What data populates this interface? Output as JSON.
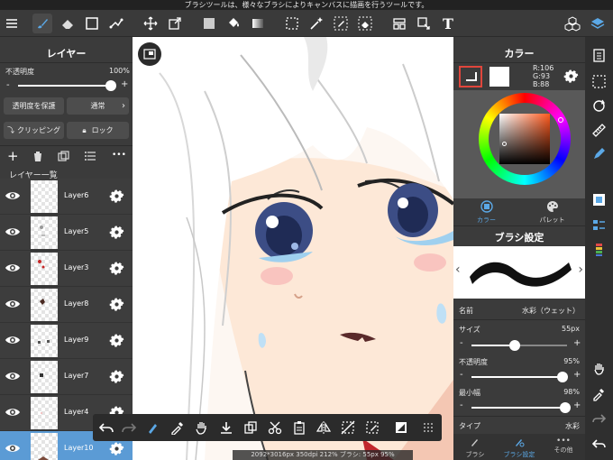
{
  "status_message": "ブラシツールは、様々なブラシによりキャンバスに描画を行うツールです。",
  "layer_panel": {
    "title": "レイヤー",
    "opacity_label": "不透明度",
    "opacity_value": "100%",
    "opacity_fraction": 1.0,
    "minus": "-",
    "plus": "+",
    "protect_alpha_label": "透明度を保護",
    "blend_mode": "通常",
    "clipping_label": "クリッピング",
    "lock_label": "ロック",
    "list_title": "レイヤー一覧",
    "more": "•••",
    "layers": [
      {
        "name": "Layer6",
        "selected": false
      },
      {
        "name": "Layer5",
        "selected": false
      },
      {
        "name": "Layer3",
        "selected": false
      },
      {
        "name": "Layer8",
        "selected": false
      },
      {
        "name": "Layer9",
        "selected": false
      },
      {
        "name": "Layer7",
        "selected": false
      },
      {
        "name": "Layer4",
        "selected": false
      },
      {
        "name": "Layer10",
        "selected": true
      }
    ]
  },
  "color_panel": {
    "title": "カラー",
    "r": "R:106",
    "g": "G:93",
    "b": "B:88",
    "tab_color": "カラー",
    "tab_palette": "パレット",
    "current_color": "#6a5d58"
  },
  "brush_panel": {
    "title": "ブラシ設定",
    "name_label": "名前",
    "name_value": "水彩（ウェット）",
    "size_label": "サイズ",
    "size_value": "55px",
    "size_fraction": 0.45,
    "opacity_label": "不透明度",
    "opacity_value": "95%",
    "opacity_fraction": 0.95,
    "min_width_label": "最小幅",
    "min_width_value": "98%",
    "min_width_fraction": 0.98,
    "type_label": "タイプ",
    "type_value": "水彩",
    "tab_brush": "ブラシ",
    "tab_brush_settings": "ブラシ設定",
    "tab_other": "その他",
    "more": "•••"
  },
  "canvas_info": "2092*3016px 350dpi 212% ブラシ: 55px 95%",
  "top_toolbar_text_tool": "T",
  "colors": {
    "accent_blue": "#5b9bd5",
    "panel_bg": "#3b3b3b",
    "toolbar_bg": "#3a3a3a"
  }
}
